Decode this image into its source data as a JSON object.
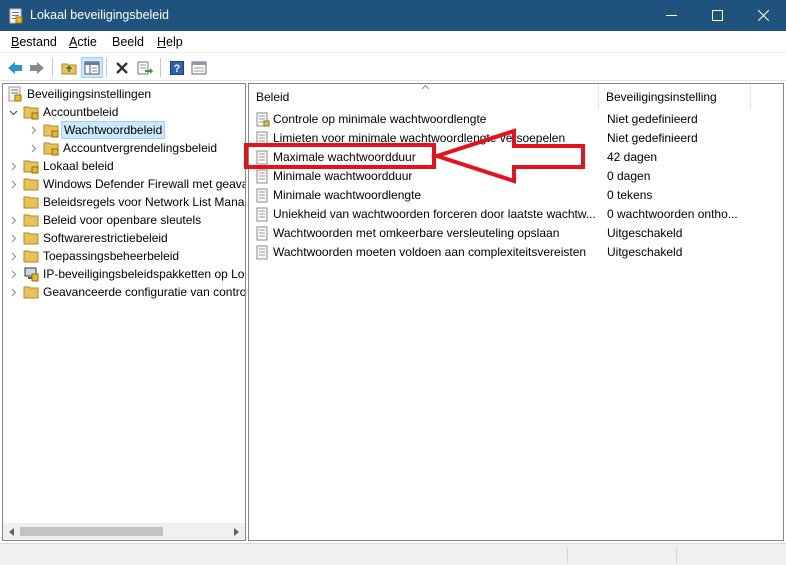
{
  "window": {
    "title": "Lokaal beveiligingsbeleid",
    "minimize_icon": "minimize-icon",
    "maximize_icon": "maximize-icon",
    "close_icon": "close-icon"
  },
  "menu": {
    "items": [
      {
        "accel": "B",
        "rest": "estand"
      },
      {
        "accel": "A",
        "rest": "ctie"
      },
      {
        "accel": "",
        "rest": "Beeld"
      },
      {
        "accel": "H",
        "rest": "elp"
      }
    ]
  },
  "toolbar": {
    "buttons": [
      "back-arrow-icon",
      "forward-arrow-icon",
      "up-folder-icon",
      "show-hide-tree-icon",
      "delete-icon",
      "export-list-icon",
      "help-icon",
      "properties-icon"
    ]
  },
  "tree": {
    "root": "Beveiligingsinstellingen",
    "items": [
      {
        "label": "Accountbeleid",
        "expanded": true
      },
      {
        "label": "Wachtwoordbeleid",
        "selected": true
      },
      {
        "label": "Accountvergrendelingsbeleid"
      },
      {
        "label": "Lokaal beleid"
      },
      {
        "label": "Windows Defender Firewall met geava"
      },
      {
        "label": "Beleidsregels voor Network List Mana"
      },
      {
        "label": "Beleid voor openbare sleutels"
      },
      {
        "label": "Softwarerestrictiebeleid"
      },
      {
        "label": "Toepassingsbeheerbeleid"
      },
      {
        "label": "IP-beveiligingsbeleidspakketten op Lo"
      },
      {
        "label": "Geavanceerde configuratie van contro"
      }
    ]
  },
  "list": {
    "columns": [
      "Beleid",
      "Beveiligingsinstelling"
    ],
    "rows": [
      {
        "name": "Controle op minimale wachtwoordlengte",
        "setting": "Niet gedefinieerd"
      },
      {
        "name": "Limieten voor minimale wachtwoordlengte versoepelen",
        "setting": "Niet gedefinieerd"
      },
      {
        "name": "Maximale wachtwoordduur",
        "setting": "42 dagen"
      },
      {
        "name": "Minimale wachtwoordduur",
        "setting": "0 dagen"
      },
      {
        "name": "Minimale wachtwoordlengte",
        "setting": "0 tekens"
      },
      {
        "name": "Uniekheid van wachtwoorden forceren door laatste wachtw...",
        "setting": "0 wachtwoorden ontho..."
      },
      {
        "name": "Wachtwoorden met omkeerbare versleuteling opslaan",
        "setting": "Uitgeschakeld"
      },
      {
        "name": "Wachtwoorden moeten voldoen aan complexiteitsvereisten",
        "setting": "Uitgeschakeld"
      }
    ]
  },
  "colors": {
    "titlebar": "#1f527c",
    "selection": "#cce8ff",
    "annotation_red": "#e3131d"
  }
}
